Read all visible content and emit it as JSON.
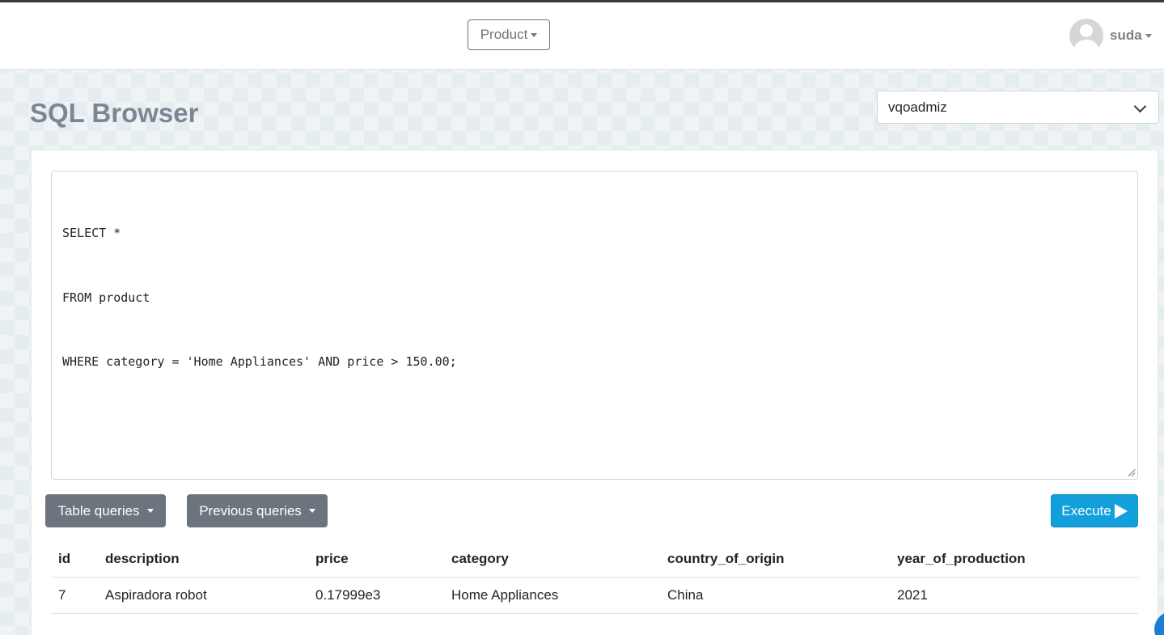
{
  "navbar": {
    "product_menu_label": "Product",
    "user_name": "suda"
  },
  "page": {
    "title": "SQL Browser"
  },
  "database_select": {
    "selected": "vqoadmiz"
  },
  "editor": {
    "lines": [
      "SELECT *",
      "FROM product",
      "WHERE category = 'Home Appliances' AND price > 150.00;"
    ]
  },
  "toolbar": {
    "table_queries_label": "Table queries",
    "previous_queries_label": "Previous queries",
    "execute_label": "Execute"
  },
  "results": {
    "columns": [
      "id",
      "description",
      "price",
      "category",
      "country_of_origin",
      "year_of_production"
    ],
    "rows": [
      [
        "7",
        "Aspiradora robot",
        "0.17999e3",
        "Home Appliances",
        "China",
        "2021"
      ]
    ]
  },
  "colors": {
    "execute": "#139fdb",
    "secondary": "#6c757d",
    "title": "#7c8793"
  },
  "icons": [
    "caret-down-icon",
    "user-avatar-icon",
    "chevron-down-icon",
    "play-icon",
    "resize-grip-icon"
  ]
}
